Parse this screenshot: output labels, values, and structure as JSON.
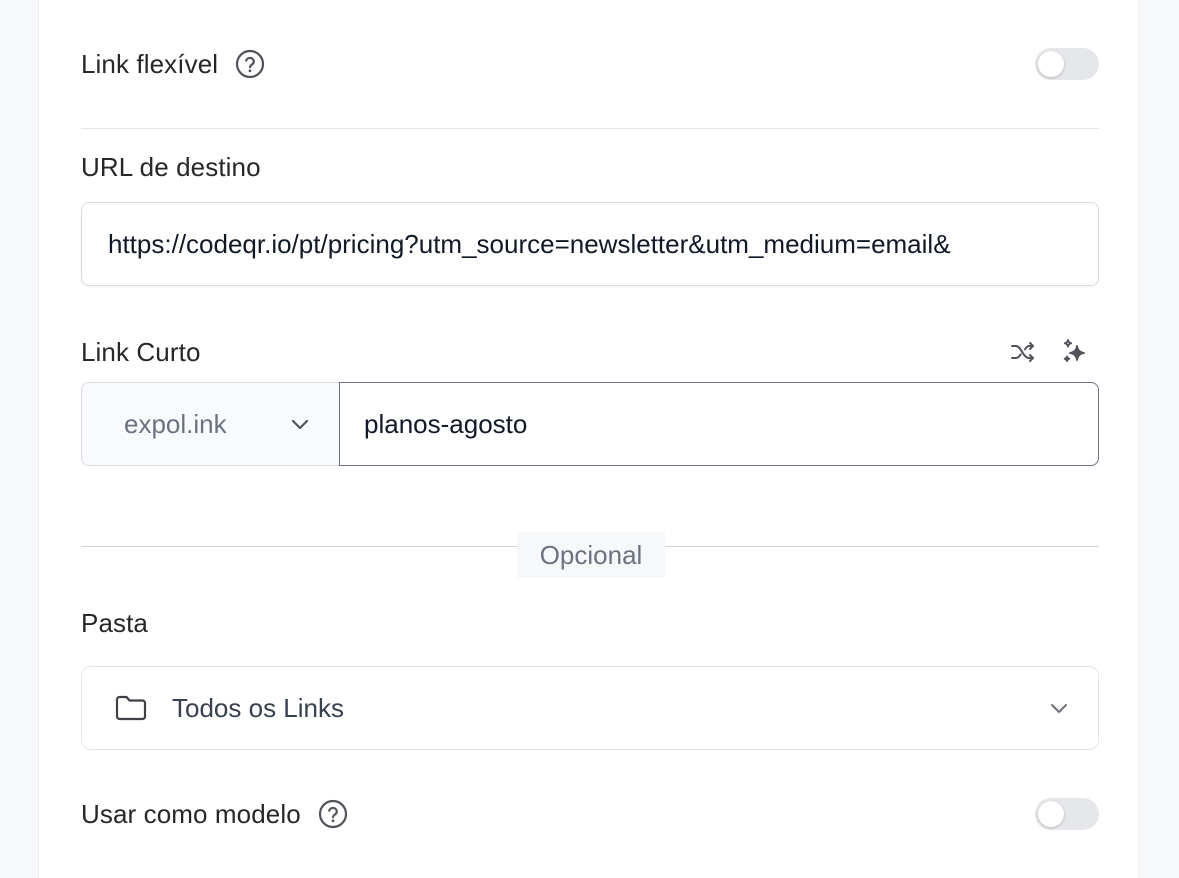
{
  "flexible_link": {
    "label": "Link flexível",
    "enabled": false
  },
  "destination": {
    "label": "URL de destino",
    "value": "https://codeqr.io/pt/pricing?utm_source=newsletter&utm_medium=email&"
  },
  "short_link": {
    "label": "Link Curto",
    "domain": "expol.ink",
    "key": "planos-agosto",
    "icons": [
      "shuffle-icon",
      "sparkles-icon"
    ]
  },
  "optional_label": "Opcional",
  "folder": {
    "label": "Pasta",
    "value": "Todos os Links"
  },
  "use_as_template": {
    "label": "Usar como modelo",
    "enabled": false
  },
  "colors": {
    "text": "#27272a",
    "muted": "#6b7280",
    "border": "#d9dbe0",
    "toggle_off": "#e5e7eb"
  }
}
